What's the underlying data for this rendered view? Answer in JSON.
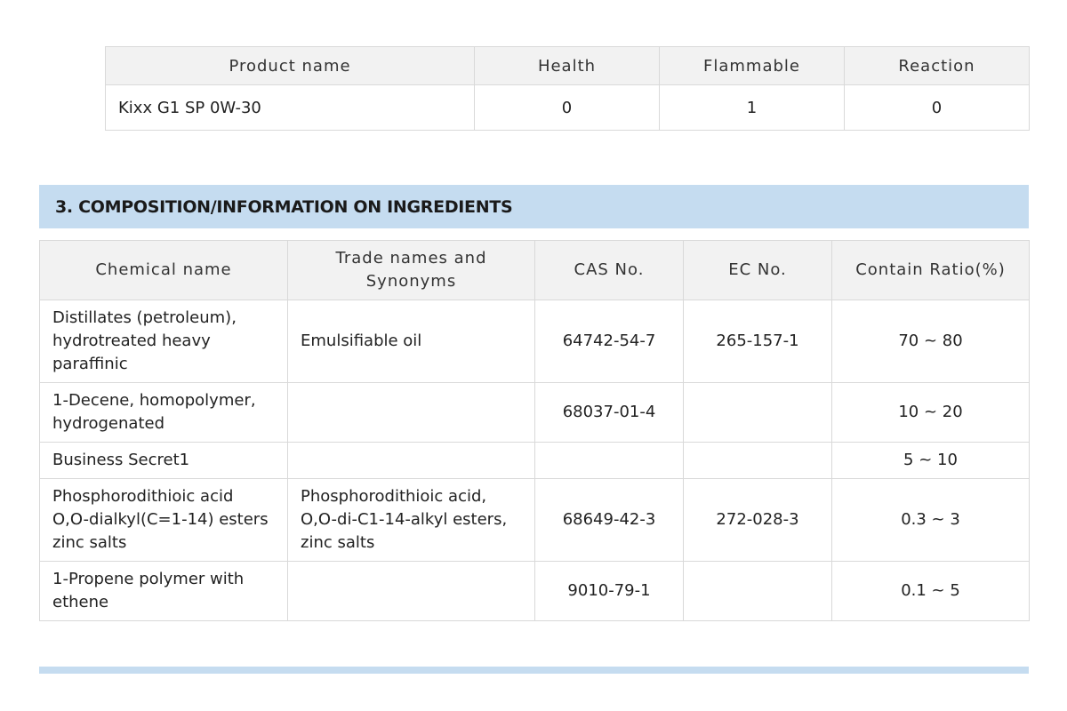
{
  "nfpa_table": {
    "headers": [
      "Product name",
      "Health",
      "Flammable",
      "Reaction"
    ],
    "row": [
      "Kixx G1 SP 0W-30",
      "0",
      "1",
      "0"
    ]
  },
  "section3": {
    "title": "3. COMPOSITION/INFORMATION ON INGREDIENTS"
  },
  "composition_table": {
    "headers": [
      "Chemical name",
      "Trade names and Synonyms",
      "CAS No.",
      "EC No.",
      "Contain Ratio(%)"
    ],
    "rows": [
      [
        "Distillates (petroleum), hydrotreated heavy paraffinic",
        "Emulsifiable oil",
        "64742-54-7",
        "265-157-1",
        "70 ~ 80"
      ],
      [
        "1-Decene, homopolymer, hydrogenated",
        "",
        "68037-01-4",
        "",
        "10 ~ 20"
      ],
      [
        "Business Secret1",
        "",
        "",
        "",
        "5 ~ 10"
      ],
      [
        "Phosphorodithioic acid O,O-dialkyl(C=1-14) esters zinc salts",
        "Phosphorodithioic acid, O,O-di-C1-14-alkyl esters, zinc salts",
        "68649-42-3",
        "272-028-3",
        "0.3 ~ 3"
      ],
      [
        "1-Propene polymer with ethene",
        "",
        "9010-79-1",
        "",
        "0.1 ~ 5"
      ]
    ]
  }
}
